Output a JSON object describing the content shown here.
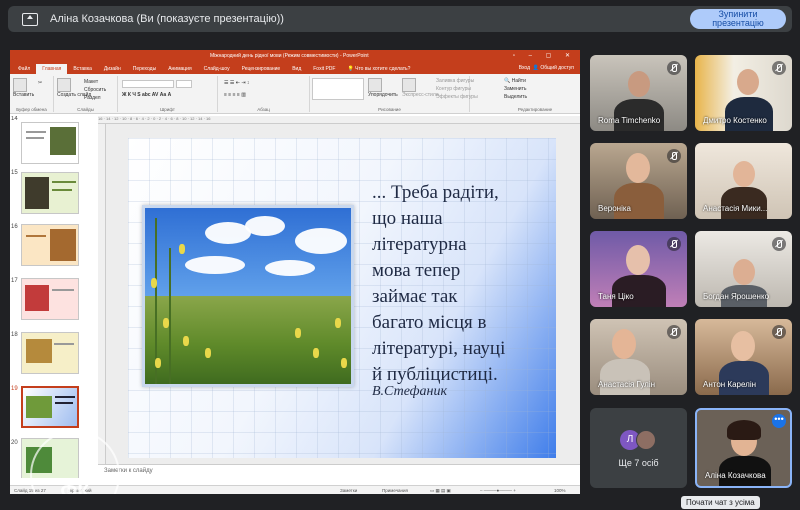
{
  "meet": {
    "presenting_title": "Аліна Козачкова (Ви (показуєте презентацію))",
    "stop_button": "Зупинити\nпрезентацію",
    "tooltip": "Почати чат з усіма"
  },
  "ppt": {
    "window_title": "Міжнародний день рідної мови (Режим совместимости) - PowerPoint",
    "tabs": [
      "Файл",
      "Главная",
      "Вставка",
      "Дизайн",
      "Переходы",
      "Анимация",
      "Слайд-шоу",
      "Рецензирование",
      "Вид",
      "Foxit PDF"
    ],
    "tell_me": "Что вы хотите сделать?",
    "sign_in": "Вход",
    "share": "Общий доступ",
    "ribbon": {
      "paste": "Вставить",
      "create_slide": "Создать слайд",
      "layout": "Макет",
      "reset": "Сбросить",
      "section": "Раздел",
      "clipboard": "Буфер обмена",
      "slides": "Слайды",
      "font": "Шрифт",
      "paragraph": "Абзац",
      "drawing": "Рисование",
      "arrange": "Упорядочить",
      "quick_styles": "Экспресс-стили",
      "shape_fill": "Заливка фигуры",
      "shape_outline": "Контур фигуры",
      "shape_effects": "Эффекты фигуры",
      "find": "Найти",
      "replace": "Заменить",
      "select": "Выделить",
      "editing": "Редактирование"
    },
    "slide_numbers": [
      "14",
      "15",
      "16",
      "17",
      "18",
      "19",
      "20"
    ],
    "slide": {
      "quote_lines": [
        "... Треба радіти,",
        "що наша",
        "літературна",
        "мова тепер",
        "займає так",
        "багато місця в",
        "літературі, науці",
        "й публіцистиці."
      ],
      "author": "В.Стефаник"
    },
    "notes_placeholder": "Заметки к слайду",
    "status": {
      "slide_of": "Слайд 19 из 27",
      "language": "украинский",
      "notes": "Заметки",
      "comments": "Примечания",
      "zoom": "100%"
    },
    "watermark_text": "ФК"
  },
  "participants": [
    {
      "name": "Roma Timchenko"
    },
    {
      "name": "Дмитро Костенко"
    },
    {
      "name": "Вероніка"
    },
    {
      "name": "Анастасія Мики..."
    },
    {
      "name": "Таня Ціко"
    },
    {
      "name": "Богдан Ярошенко"
    },
    {
      "name": "Анастасія Гулін"
    },
    {
      "name": "Антон Карелін"
    }
  ],
  "others_tile": {
    "label": "Ще 7 осіб",
    "avatar_letter": "Л",
    "avatar_color": "#7e57c2"
  },
  "self": {
    "name": "Аліна Козачкова",
    "more_icon": "more-vert-icon"
  }
}
